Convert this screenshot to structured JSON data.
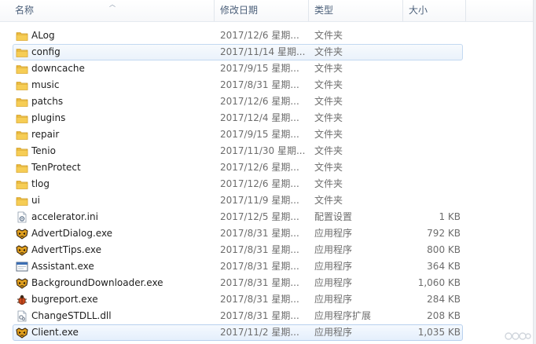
{
  "header": {
    "name_label": "名称",
    "date_label": "修改日期",
    "type_label": "类型",
    "size_label": "大小",
    "sort_icon": "sort-ascending-icon"
  },
  "colors": {
    "selection_fill": "#e4effc",
    "selection_border": "#b9d1ee",
    "header_text": "#4c607a",
    "secondary_text": "#6d6d6d",
    "folder_yellow": "#f5c842"
  },
  "files": [
    {
      "name": "ALog",
      "date": "2017/12/6 星期...",
      "type": "文件夹",
      "size": "",
      "icon": "folder"
    },
    {
      "name": "config",
      "date": "2017/11/14 星期...",
      "type": "文件夹",
      "size": "",
      "icon": "folder",
      "state": "hovered"
    },
    {
      "name": "downcache",
      "date": "2017/9/15 星期...",
      "type": "文件夹",
      "size": "",
      "icon": "folder"
    },
    {
      "name": "music",
      "date": "2017/8/31 星期...",
      "type": "文件夹",
      "size": "",
      "icon": "folder"
    },
    {
      "name": "patchs",
      "date": "2017/12/6 星期...",
      "type": "文件夹",
      "size": "",
      "icon": "folder"
    },
    {
      "name": "plugins",
      "date": "2017/12/4 星期...",
      "type": "文件夹",
      "size": "",
      "icon": "folder"
    },
    {
      "name": "repair",
      "date": "2017/9/15 星期...",
      "type": "文件夹",
      "size": "",
      "icon": "folder"
    },
    {
      "name": "Tenio",
      "date": "2017/11/30 星期...",
      "type": "文件夹",
      "size": "",
      "icon": "folder"
    },
    {
      "name": "TenProtect",
      "date": "2017/12/6 星期...",
      "type": "文件夹",
      "size": "",
      "icon": "folder"
    },
    {
      "name": "tlog",
      "date": "2017/12/6 星期...",
      "type": "文件夹",
      "size": "",
      "icon": "folder"
    },
    {
      "name": "ui",
      "date": "2017/11/9 星期...",
      "type": "文件夹",
      "size": "",
      "icon": "folder"
    },
    {
      "name": "accelerator.ini",
      "date": "2017/12/5 星期...",
      "type": "配置设置",
      "size": "1 KB",
      "icon": "ini"
    },
    {
      "name": "AdvertDialog.exe",
      "date": "2017/8/31 星期...",
      "type": "应用程序",
      "size": "792 KB",
      "icon": "game-exe"
    },
    {
      "name": "AdvertTips.exe",
      "date": "2017/8/31 星期...",
      "type": "应用程序",
      "size": "800 KB",
      "icon": "game-exe"
    },
    {
      "name": "Assistant.exe",
      "date": "2017/8/31 星期...",
      "type": "应用程序",
      "size": "364 KB",
      "icon": "window-exe"
    },
    {
      "name": "BackgroundDownloader.exe",
      "date": "2017/8/31 星期...",
      "type": "应用程序",
      "size": "1,060 KB",
      "icon": "game-exe"
    },
    {
      "name": "bugreport.exe",
      "date": "2017/8/31 星期...",
      "type": "应用程序",
      "size": "284 KB",
      "icon": "bug-exe"
    },
    {
      "name": "ChangeSTDLL.dll",
      "date": "2017/8/31 星期...",
      "type": "应用程序扩展",
      "size": "208 KB",
      "icon": "dll"
    },
    {
      "name": "Client.exe",
      "date": "2017/11/2 星期...",
      "type": "应用程序",
      "size": "1,035 KB",
      "icon": "game-exe",
      "state": "selected"
    }
  ]
}
